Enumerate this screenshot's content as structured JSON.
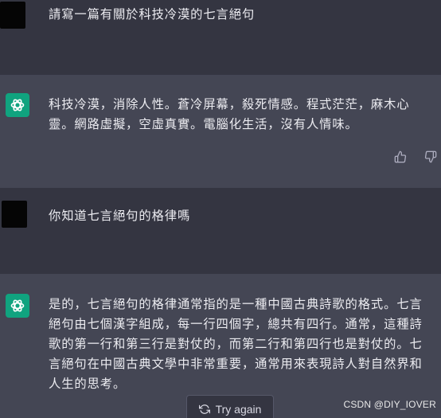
{
  "conversation": {
    "messages": [
      {
        "role": "user",
        "text": "請寫一篇有關於科技冷漠的七言絕句"
      },
      {
        "role": "assistant",
        "lines": [
          "科技冷漠，消除人性。蒼冷屏幕，殺死情感。程式茫茫，麻木心",
          "靈。網路虛擬，空虛真實。電腦化生活，沒有人情味。"
        ]
      },
      {
        "role": "user",
        "text": "你知道七言絕句的格律嗎"
      },
      {
        "role": "assistant",
        "lines": [
          "是的，七言絕句的格律通常指的是一種中國古典詩歌的格式。七言",
          "絕句由七個漢字組成，每一行四個字，總共有四行。通常，這種詩",
          "歌的第一行和第三行是對仗的，而第二行和第四行也是對仗的。七",
          "言絕句在中國古典文學中非常重要，通常用來表現詩人對自然界和",
          "人生的思考。"
        ]
      }
    ]
  },
  "actions": {
    "try_again_label": "Try again",
    "thumbs_up_icon": "thumbs-up-icon",
    "thumbs_down_icon": "thumbs-down-icon",
    "refresh_icon": "refresh-icon"
  },
  "watermark": {
    "text": "CSDN @DIY_IOVER"
  },
  "colors": {
    "user_bg": "#343541",
    "assistant_bg": "#444654",
    "accent_green": "#10a37f",
    "text": "#ececf1"
  }
}
